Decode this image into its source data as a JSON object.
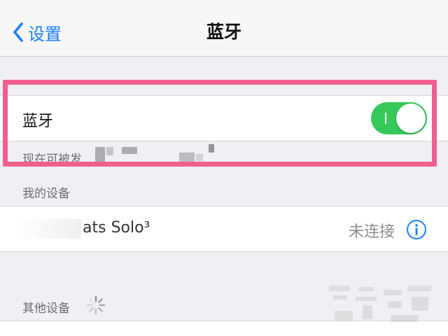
{
  "navbar": {
    "back_label": "设置",
    "back_icon": "chevron-left-icon",
    "title": "蓝牙"
  },
  "bluetooth": {
    "label": "蓝牙",
    "toggle_on": true,
    "discoverable_text": "现在可被发"
  },
  "my_devices": {
    "header": "我的设备",
    "items": [
      {
        "name": "ats Solo³",
        "status": "未连接",
        "icon": "info-icon"
      }
    ]
  },
  "other_devices": {
    "header": "其他设备",
    "icon": "loading-spinner-icon"
  },
  "colors": {
    "accent": "#1a7ef7",
    "toggle_on": "#36c95a",
    "highlight": "#f0608e",
    "background": "#efeff4"
  }
}
